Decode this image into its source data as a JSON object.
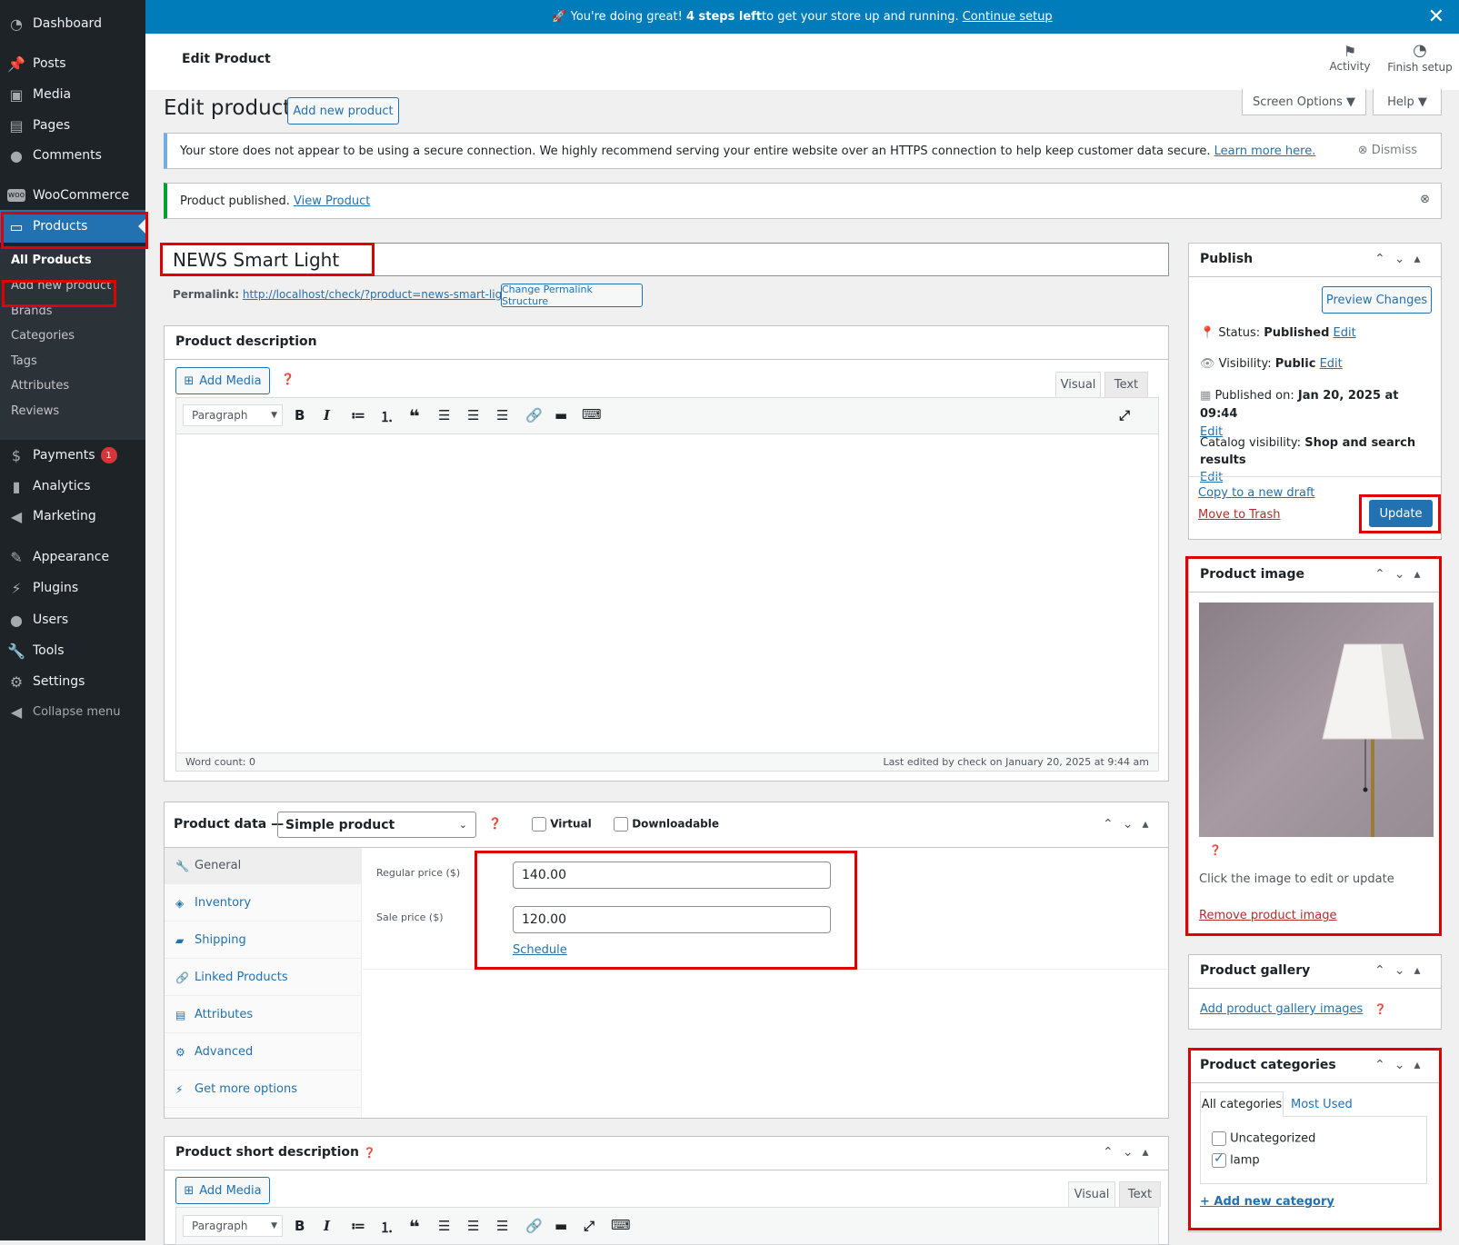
{
  "sidebar": {
    "items": [
      {
        "label": "Dashboard",
        "icon": "dashboard-icon"
      },
      {
        "label": "Posts",
        "icon": "pin-icon"
      },
      {
        "label": "Media",
        "icon": "media-icon"
      },
      {
        "label": "Pages",
        "icon": "page-icon"
      },
      {
        "label": "Comments",
        "icon": "comment-icon"
      },
      {
        "label": "WooCommerce",
        "icon": "woo-icon"
      },
      {
        "label": "Products",
        "icon": "archive-icon"
      },
      {
        "label": "Payments",
        "icon": "dollar-icon",
        "badge": "1"
      },
      {
        "label": "Analytics",
        "icon": "bar-chart-icon"
      },
      {
        "label": "Marketing",
        "icon": "megaphone-icon"
      },
      {
        "label": "Appearance",
        "icon": "brush-icon"
      },
      {
        "label": "Plugins",
        "icon": "plug-icon"
      },
      {
        "label": "Users",
        "icon": "user-icon"
      },
      {
        "label": "Tools",
        "icon": "wrench-icon"
      },
      {
        "label": "Settings",
        "icon": "settings-icon"
      },
      {
        "label": "Collapse menu",
        "icon": "collapse-icon"
      }
    ],
    "submenu": [
      "All Products",
      "Add new product",
      "Brands",
      "Categories",
      "Tags",
      "Attributes",
      "Reviews"
    ]
  },
  "banner": {
    "pre": "🚀 You're doing great! ",
    "bold": "4 steps left",
    "post": " to get your store up and running. ",
    "link": "Continue setup"
  },
  "topbar": {
    "title": "Edit Product",
    "activity": "Activity",
    "finish": "Finish setup"
  },
  "page": {
    "heading": "Edit product",
    "add_new": "Add new product",
    "screen_options": "Screen Options ▼",
    "help": "Help ▼"
  },
  "notices": {
    "https_text": "Your store does not appear to be using a secure connection. We highly recommend serving your entire website over an HTTPS connection to help keep customer data secure.",
    "https_link": "Learn more here.",
    "dismiss": "Dismiss",
    "published_text": "Product published.",
    "view_product": "View Product"
  },
  "product": {
    "title": "NEWS Smart Light",
    "permalink_label": "Permalink:",
    "permalink_url": "http://localhost/check/?product=news-smart-light",
    "change_permalink": "Change Permalink Structure"
  },
  "description": {
    "heading": "Product description",
    "add_media": "Add Media",
    "tab_visual": "Visual",
    "tab_text": "Text",
    "format": "Paragraph",
    "word_count": "Word count: 0",
    "last_edited": "Last edited by check on January 20, 2025 at 9:44 am"
  },
  "product_data": {
    "heading": "Product data —",
    "type": "Simple product",
    "virtual": "Virtual",
    "downloadable": "Downloadable",
    "tabs": [
      "General",
      "Inventory",
      "Shipping",
      "Linked Products",
      "Attributes",
      "Advanced",
      "Get more options"
    ],
    "regular_label": "Regular price ($)",
    "regular_value": "140.00",
    "sale_label": "Sale price ($)",
    "sale_value": "120.00",
    "schedule": "Schedule"
  },
  "short_desc": {
    "heading": "Product short description",
    "add_media": "Add Media",
    "tab_visual": "Visual",
    "tab_text": "Text",
    "format": "Paragraph"
  },
  "publish": {
    "heading": "Publish",
    "preview": "Preview Changes",
    "status_label": "Status: ",
    "status": "Published",
    "visibility_label": "Visibility: ",
    "visibility": "Public",
    "published_label": "Published on: ",
    "published": "Jan 20, 2025 at 09:44",
    "catalog_label": "Catalog visibility: ",
    "catalog": "Shop and search results",
    "edit": "Edit",
    "copy": "Copy to a new draft",
    "trash": "Move to Trash",
    "update": "Update"
  },
  "product_image": {
    "heading": "Product image",
    "hint": "Click the image to edit or update",
    "remove": "Remove product image"
  },
  "gallery": {
    "heading": "Product gallery",
    "add": "Add product gallery images"
  },
  "categories": {
    "heading": "Product categories",
    "tab_all": "All categories",
    "tab_used": "Most Used",
    "items": [
      {
        "label": "Uncategorized",
        "checked": false
      },
      {
        "label": "lamp",
        "checked": true
      }
    ],
    "add": "+ Add new category"
  },
  "colors": {
    "accent": "#2271b1",
    "sidebar": "#1d2327",
    "banner": "#007cba",
    "highlight": "#e00000"
  }
}
